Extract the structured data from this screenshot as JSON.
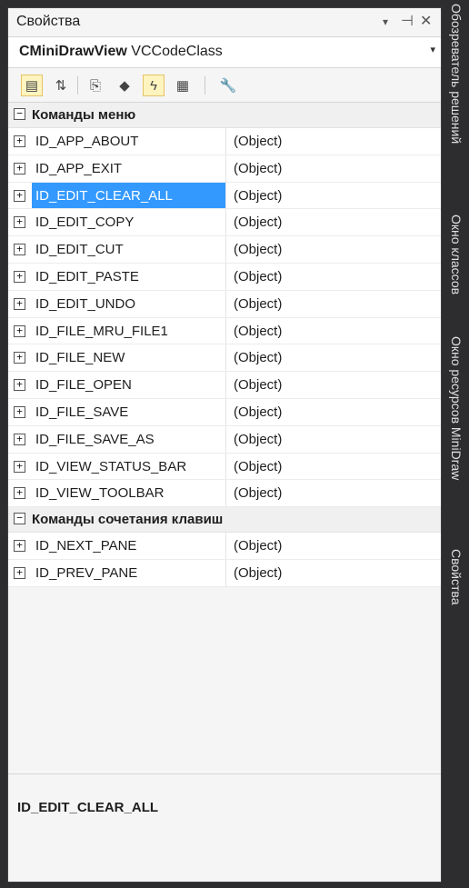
{
  "panel": {
    "title": "Свойства",
    "title_buttons": {
      "dropdown": "▾",
      "pin": "⊣",
      "close": "✕"
    }
  },
  "object_selector": {
    "class_bold": "CMiniDrawView",
    "class_rest": "VCCodeClass",
    "dropdown": "▾"
  },
  "toolbar": {
    "buttons": [
      {
        "name": "categorized",
        "glyph": "▤",
        "active": true
      },
      {
        "name": "alphabetical",
        "glyph": "⇅",
        "active": false
      },
      {
        "name": "properties",
        "glyph": "⎘",
        "active": false
      },
      {
        "name": "events",
        "glyph": "◆",
        "active": false
      },
      {
        "name": "messages",
        "glyph": "ϟ",
        "active": true
      },
      {
        "name": "overrides",
        "glyph": "▦",
        "active": false
      },
      {
        "name": "property-pages",
        "glyph": "🔧",
        "active": false
      }
    ]
  },
  "grid": {
    "categories": [
      {
        "label": "Команды меню",
        "expander": "−",
        "rows": [
          {
            "name": "ID_APP_ABOUT",
            "value": "(Object)",
            "expander": "+"
          },
          {
            "name": "ID_APP_EXIT",
            "value": "(Object)",
            "expander": "+"
          },
          {
            "name": "ID_EDIT_CLEAR_ALL",
            "value": "(Object)",
            "expander": "+",
            "selected": true
          },
          {
            "name": "ID_EDIT_COPY",
            "value": "(Object)",
            "expander": "+"
          },
          {
            "name": "ID_EDIT_CUT",
            "value": "(Object)",
            "expander": "+"
          },
          {
            "name": "ID_EDIT_PASTE",
            "value": "(Object)",
            "expander": "+"
          },
          {
            "name": "ID_EDIT_UNDO",
            "value": "(Object)",
            "expander": "+"
          },
          {
            "name": "ID_FILE_MRU_FILE1",
            "value": "(Object)",
            "expander": "+"
          },
          {
            "name": "ID_FILE_NEW",
            "value": "(Object)",
            "expander": "+"
          },
          {
            "name": "ID_FILE_OPEN",
            "value": "(Object)",
            "expander": "+"
          },
          {
            "name": "ID_FILE_SAVE",
            "value": "(Object)",
            "expander": "+"
          },
          {
            "name": "ID_FILE_SAVE_AS",
            "value": "(Object)",
            "expander": "+"
          },
          {
            "name": "ID_VIEW_STATUS_BAR",
            "value": "(Object)",
            "expander": "+"
          },
          {
            "name": "ID_VIEW_TOOLBAR",
            "value": "(Object)",
            "expander": "+"
          }
        ]
      },
      {
        "label": "Команды сочетания клавиш",
        "expander": "−",
        "rows": [
          {
            "name": "ID_NEXT_PANE",
            "value": "(Object)",
            "expander": "+"
          },
          {
            "name": "ID_PREV_PANE",
            "value": "(Object)",
            "expander": "+"
          }
        ]
      }
    ]
  },
  "description": {
    "title": "ID_EDIT_CLEAR_ALL"
  },
  "side_tabs": [
    "Обозреватель решений",
    "Окно классов",
    "Окно ресурсов MiniDraw",
    "Свойства"
  ],
  "colors": {
    "selection": "#3399ff",
    "chrome": "#2d2d30"
  }
}
